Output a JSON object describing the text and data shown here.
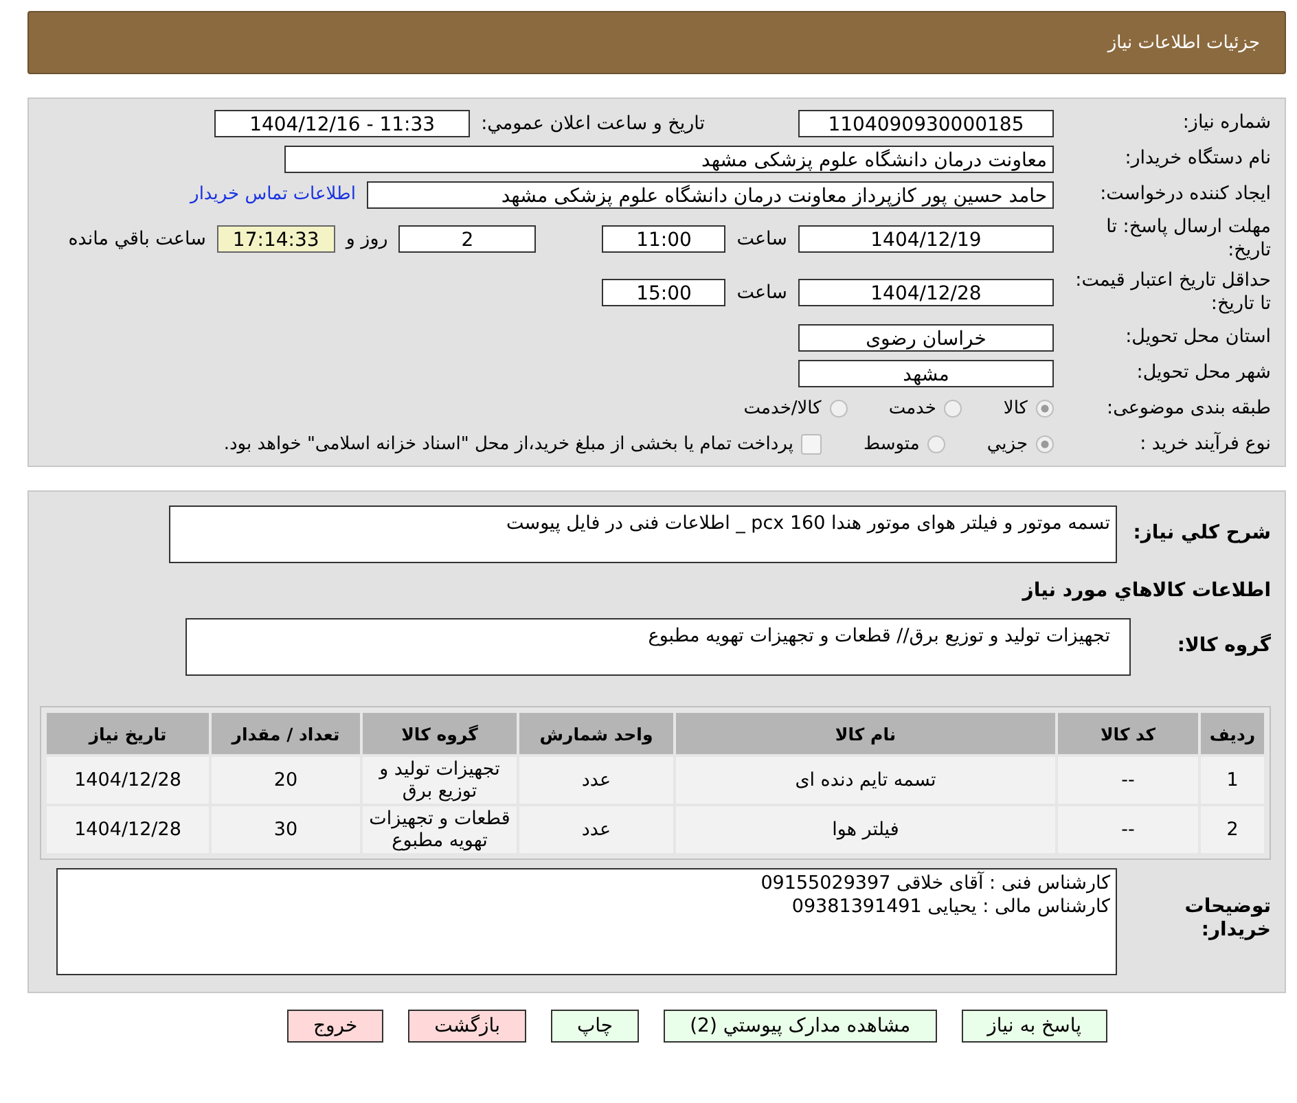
{
  "header": {
    "title": "جزئيات اطلاعات نياز"
  },
  "details": {
    "need_number": {
      "label": "شماره نیاز:",
      "value": "1104090930000185"
    },
    "announce": {
      "label": "تاريخ و ساعت اعلان عمومي:",
      "value": "1404/12/16 - 11:33"
    },
    "buyer": {
      "label": "نام دستگاه خریدار:",
      "value": "معاونت درمان دانشگاه علوم پزشکی مشهد"
    },
    "requester": {
      "label": "ایجاد کننده درخواست:",
      "value": "حامد حسین پور کازپرداز معاونت درمان دانشگاه علوم پزشکی مشهد",
      "link": "اطلاعات تماس خریدار"
    },
    "reply_deadline": {
      "label": "مهلت ارسال پاسخ: تا تاریخ:",
      "date": "1404/12/19",
      "time_label": "ساعت",
      "time": "11:00",
      "days": "2",
      "days_label": "روز و",
      "remaining": "17:14:33",
      "remaining_label": "ساعت باقي مانده"
    },
    "validity": {
      "label": "حداقل تاریخ اعتبار قیمت: تا تاریخ:",
      "date": "1404/12/28",
      "time_label": "ساعت",
      "time": "15:00"
    },
    "province": {
      "label": "استان محل تحویل:",
      "value": "خراسان رضوی"
    },
    "city": {
      "label": "شهر محل تحویل:",
      "value": "مشهد"
    },
    "category": {
      "label": "طبقه بندی موضوعی:",
      "options": [
        {
          "label": "کالا",
          "selected": true
        },
        {
          "label": "خدمت",
          "selected": false
        },
        {
          "label": "کالا/خدمت",
          "selected": false
        }
      ]
    },
    "process": {
      "label": "نوع فرآیند خرید :",
      "options": [
        {
          "label": "جزيي",
          "selected": true
        },
        {
          "label": "متوسط",
          "selected": false
        }
      ],
      "payment": {
        "checked": false,
        "label": "پرداخت تمام یا بخشی از مبلغ خرید،از محل \"اسناد خزانه اسلامی\" خواهد بود."
      }
    }
  },
  "goods": {
    "summary": {
      "label": "شرح کلي نياز:",
      "value": "تسمه موتور و فیلتر هوای موتور هندا pcx 160  _ اطلاعات فنی در فایل پیوست"
    },
    "section_title": "اطلاعات کالاهاي مورد نياز",
    "group": {
      "label": "گروه کالا:",
      "value": "تجهیزات تولید و توزیع برق//  قطعات و تجهیزات تهویه مطبوع"
    },
    "table": {
      "columns": [
        "رديف",
        "کد کالا",
        "نام کالا",
        "واحد شمارش",
        "گروه کالا",
        "تعداد / مقدار",
        "تاريخ نياز"
      ],
      "rows": [
        [
          "1",
          "--",
          "تسمه تایم دنده ای",
          "عدد",
          "تجهیزات تولید و توزیع برق",
          "20",
          "1404/12/28"
        ],
        [
          "2",
          "--",
          "فیلتر هوا",
          "عدد",
          "قطعات و تجهیزات تهویه مطبوع",
          "30",
          "1404/12/28"
        ]
      ]
    },
    "notes": {
      "label": "توضیحات خریدار:",
      "lines": [
        "کارشناس فنی : آقای خلاقی 09155029397",
        "کارشناس مالی : یحیایی 09381391491"
      ]
    }
  },
  "buttons": [
    {
      "label": "پاسخ به نیاز",
      "kind": "normal"
    },
    {
      "label": "مشاهده مدارک پیوستي (2)",
      "kind": "normal"
    },
    {
      "label": "چاپ",
      "kind": "normal"
    },
    {
      "label": "بازگشت",
      "kind": "danger"
    },
    {
      "label": "خروج",
      "kind": "danger"
    }
  ]
}
